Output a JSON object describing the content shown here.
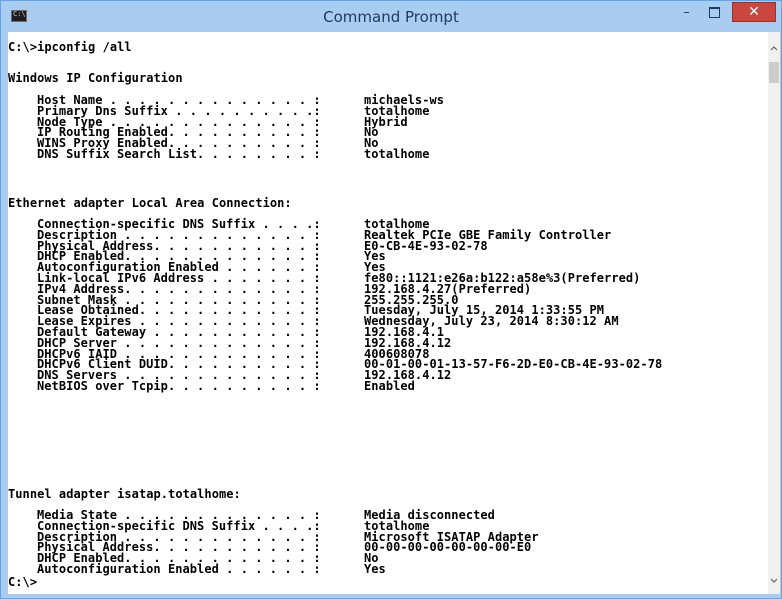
{
  "window": {
    "title": "Command Prompt",
    "close_glyph": "✕",
    "minimize_glyph": "–"
  },
  "colors": {
    "titlebar": "#a9cdf0",
    "close_button": "#c8473e",
    "console_background": "#ffffff",
    "console_text": "#000000"
  },
  "console": {
    "command_line": "C:\\>ipconfig /all",
    "windows_ip_heading": "Windows IP Configuration",
    "windows_ip": [
      {
        "label": "Host Name",
        "value": "michaels-ws"
      },
      {
        "label": "Primary Dns Suffix",
        "value": "totalhome"
      },
      {
        "label": "Node Type",
        "value": "Hybrid"
      },
      {
        "label": "IP Routing Enabled.",
        "value": "No"
      },
      {
        "label": "WINS Proxy Enabled.",
        "value": "No"
      },
      {
        "label": "DNS Suffix Search List.",
        "value": "totalhome"
      }
    ],
    "ethernet_heading": "Ethernet adapter Local Area Connection:",
    "ethernet": [
      {
        "label": "Connection-specific DNS Suffix",
        "value": "totalhome"
      },
      {
        "label": "Description",
        "value": "Realtek PCIe GBE Family Controller"
      },
      {
        "label": "Physical Address.",
        "value": "E0-CB-4E-93-02-78"
      },
      {
        "label": "DHCP Enabled.",
        "value": "Yes"
      },
      {
        "label": "Autoconfiguration Enabled",
        "value": "Yes"
      },
      {
        "label": "Link-local IPv6 Address",
        "value": "fe80::1121:e26a:b122:a58e%3(Preferred)"
      },
      {
        "label": "IPv4 Address.",
        "value": "192.168.4.27(Preferred)"
      },
      {
        "label": "Subnet Mask",
        "value": "255.255.255.0"
      },
      {
        "label": "Lease Obtained.",
        "value": "Tuesday, July 15, 2014 1:33:55 PM"
      },
      {
        "label": "Lease Expires",
        "value": "Wednesday, July 23, 2014 8:30:12 AM"
      },
      {
        "label": "Default Gateway",
        "value": "192.168.4.1"
      },
      {
        "label": "DHCP Server",
        "value": "192.168.4.12"
      },
      {
        "label": "DHCPv6 IAID",
        "value": "400608078"
      },
      {
        "label": "DHCPv6 Client DUID.",
        "value": "00-01-00-01-13-57-F6-2D-E0-CB-4E-93-02-78"
      },
      {
        "label": "DNS Servers",
        "value": "192.168.4.12"
      },
      {
        "label": "NetBIOS over Tcpip.",
        "value": "Enabled"
      }
    ],
    "tunnel_heading": "Tunnel adapter isatap.totalhome:",
    "tunnel": [
      {
        "label": "Media State",
        "value": "Media disconnected"
      },
      {
        "label": "Connection-specific DNS Suffix",
        "value": "totalhome"
      },
      {
        "label": "Description",
        "value": "Microsoft ISATAP Adapter"
      },
      {
        "label": "Physical Address.",
        "value": "00-00-00-00-00-00-00-E0"
      },
      {
        "label": "DHCP Enabled.",
        "value": "No"
      },
      {
        "label": "Autoconfiguration Enabled",
        "value": "Yes"
      }
    ],
    "prompt": "C:\\>"
  }
}
